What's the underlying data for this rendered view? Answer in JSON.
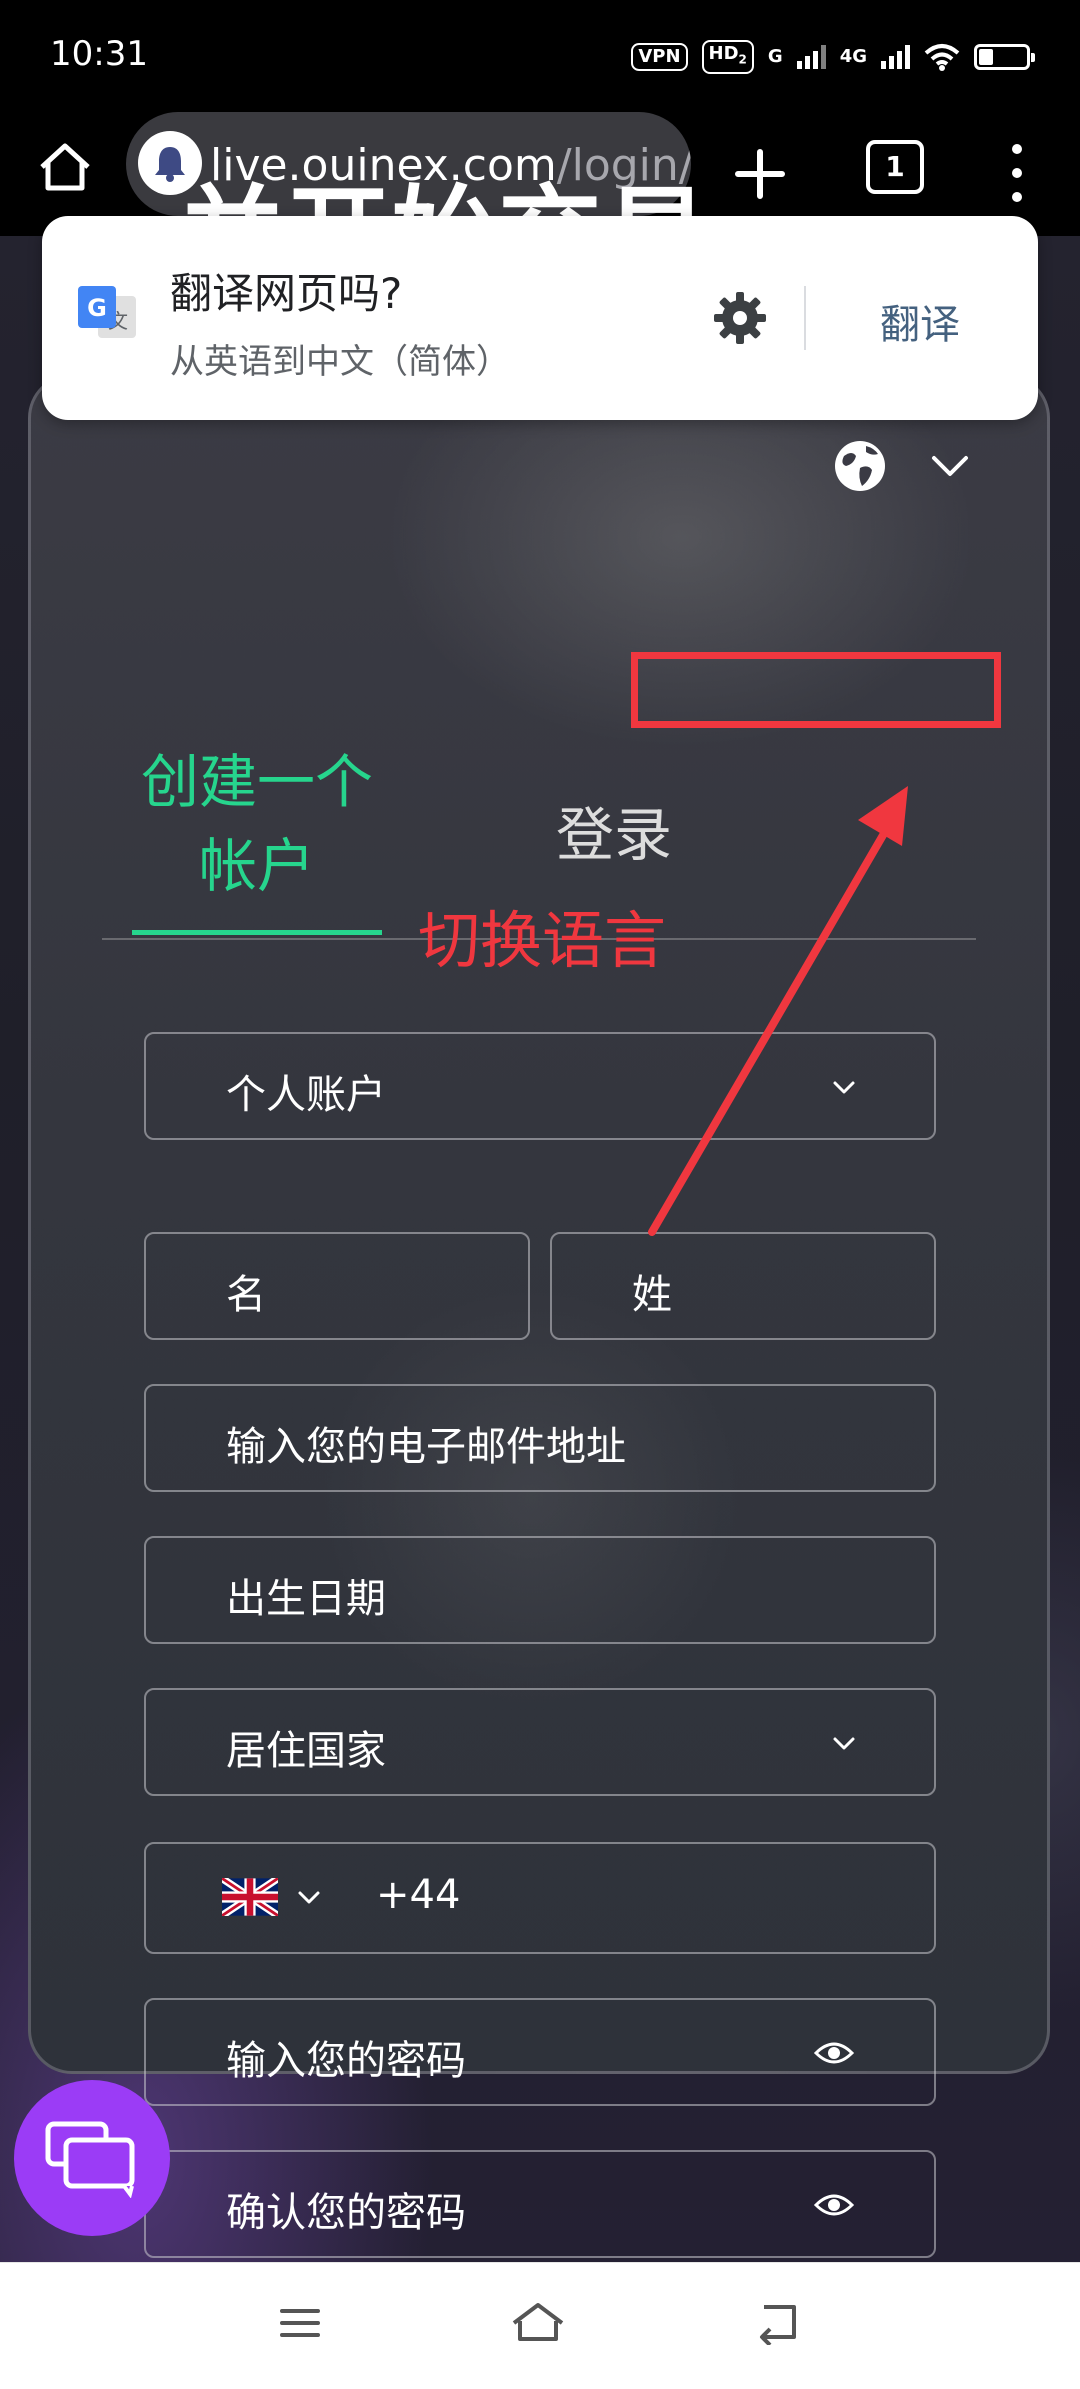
{
  "status_bar": {
    "time": "10:31",
    "vpn": "VPN",
    "hd": "HD",
    "hd_sub": "2",
    "net1": "G",
    "net2": "4G"
  },
  "browser": {
    "url_host": "live.ouinex.com",
    "url_path": "/login/",
    "tab_count": "1"
  },
  "translate_prompt": {
    "title": "翻译网页吗?",
    "subtitle": "从英语到中文（简体）",
    "action": "翻译"
  },
  "page": {
    "hero_title": "并开始交易",
    "tabs": {
      "signup": "创建一个帐户",
      "login": "登录"
    },
    "annotation": "切换语言",
    "form": {
      "account_type": "个人账户",
      "first_name": "名",
      "last_name": "姓",
      "email": "输入您的电子邮件地址",
      "birth_date": "出生日期",
      "country": "居住国家",
      "dial_code": "+44",
      "password": "输入您的密码",
      "confirm_password": "确认您的密码"
    }
  },
  "colors": {
    "accent_green": "#26d58d",
    "annotation_red": "#f0373f",
    "chat_purple": "#9b3cf6"
  },
  "icons": [
    "home-icon",
    "bell-icon",
    "plus-icon",
    "tabs-icon",
    "more-icon",
    "google-translate-icon",
    "gear-icon",
    "globe-icon",
    "chevron-down-icon",
    "uk-flag-icon",
    "eye-icon",
    "chat-icon",
    "nav-menu-icon",
    "nav-home-icon",
    "nav-back-icon"
  ]
}
